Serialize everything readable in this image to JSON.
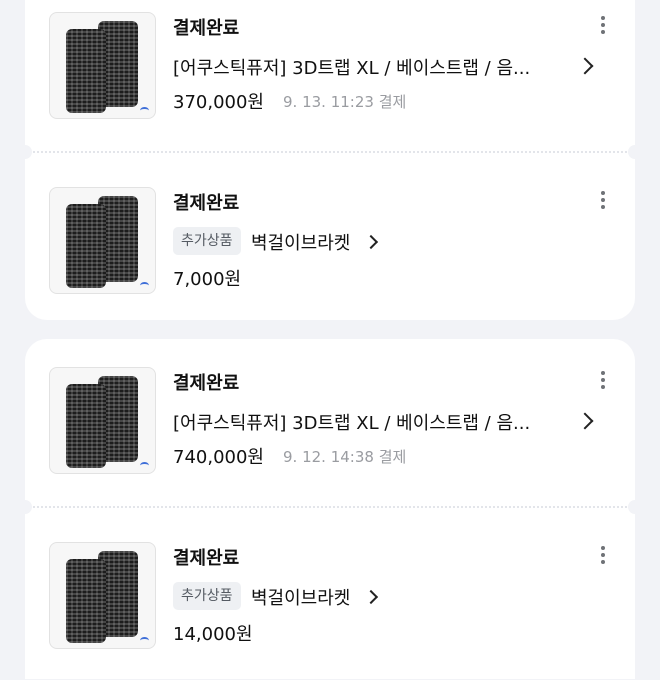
{
  "orders": [
    {
      "status": "결제완료",
      "product_name": "[어쿠스틱퓨저] 3D트랩 XL / 베이스트랩 / 음...",
      "price": "370,000원",
      "paid_at": "9. 13. 11:23 결제",
      "addon": {
        "status": "결제완료",
        "badge": "추가상품",
        "name": "벽걸이브라켓",
        "price": "7,000원"
      }
    },
    {
      "status": "결제완료",
      "product_name": "[어쿠스틱퓨저] 3D트랩 XL / 베이스트랩 / 음...",
      "price": "740,000원",
      "paid_at": "9. 12. 14:38 결제",
      "addon": {
        "status": "결제완료",
        "badge": "추가상품",
        "name": "벽걸이브라켓",
        "price": "14,000원"
      }
    }
  ],
  "icons": {
    "more": "kebab-menu-icon",
    "chevron": "chevron-right-icon"
  },
  "colors": {
    "background": "#f2f3f7",
    "card": "#ffffff",
    "text": "#111111",
    "muted": "#9a9ca1",
    "badge_bg": "#eef0f3"
  }
}
